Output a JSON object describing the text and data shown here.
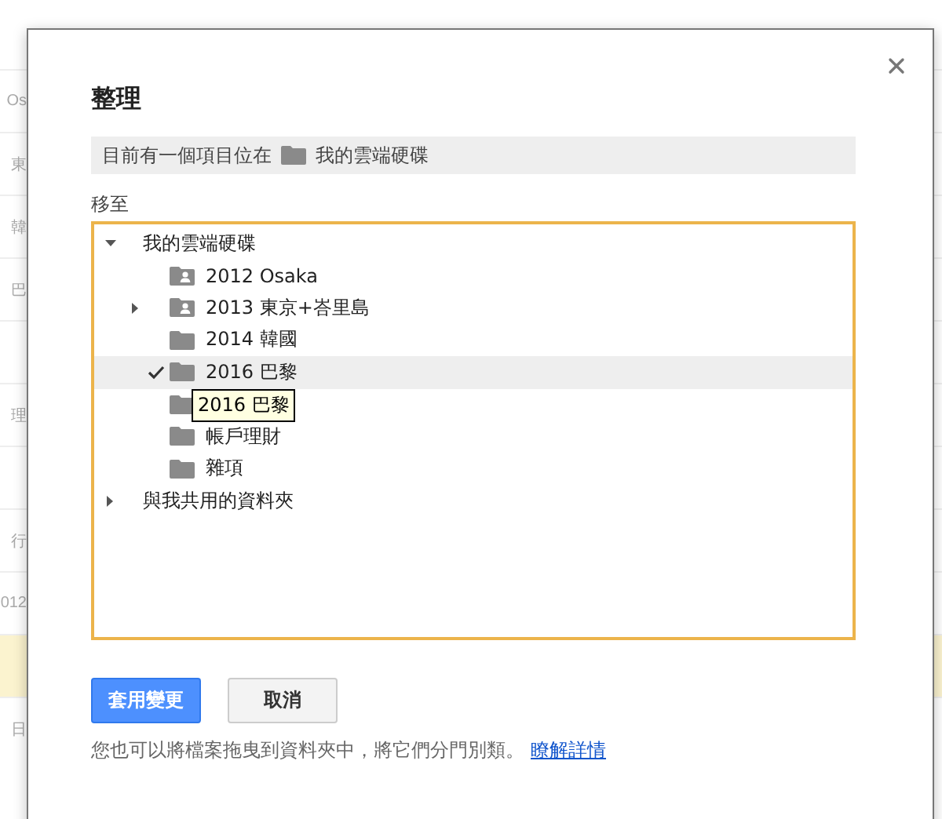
{
  "background_list": [
    {
      "text": "Os",
      "highlighted": false
    },
    {
      "text": "東",
      "highlighted": false
    },
    {
      "text": "韓",
      "highlighted": false
    },
    {
      "text": "巴",
      "highlighted": false
    },
    {
      "highlighted": false
    },
    {
      "text": "理",
      "highlighted": false
    },
    {
      "highlighted": false
    },
    {
      "text": "行",
      "highlighted": false
    },
    {
      "text": "012",
      "highlighted": false
    },
    {
      "highlighted": true
    },
    {
      "text": "日",
      "highlighted": false
    }
  ],
  "dialog": {
    "title": "整理",
    "location": {
      "prefix": "目前有一個項目位在",
      "folder": "我的雲端硬碟"
    },
    "move_to_label": "移至",
    "tree": [
      {
        "label": "我的雲端硬碟",
        "has_children": true,
        "expanded": true,
        "selected": false,
        "children": [
          {
            "label": "2012 Osaka",
            "kind": "shared_folder",
            "has_children": false,
            "selected": false
          },
          {
            "label": "2013 東京+峇里島",
            "kind": "shared_folder",
            "has_children": true,
            "expanded": false,
            "selected": false
          },
          {
            "label": "2014 韓國",
            "kind": "folder",
            "has_children": false,
            "selected": false
          },
          {
            "label": "2016 巴黎",
            "kind": "folder",
            "has_children": false,
            "selected": true
          },
          {
            "kind": "folder",
            "has_children": false,
            "selected": false
          },
          {
            "label": "帳戶理財",
            "kind": "folder",
            "has_children": false,
            "selected": false
          },
          {
            "label": "雜項",
            "kind": "folder",
            "has_children": false,
            "selected": false
          }
        ]
      },
      {
        "label": "與我共用的資料夾",
        "has_children": true,
        "expanded": false,
        "selected": false
      }
    ],
    "tooltip": "2016 巴黎",
    "buttons": [
      {
        "label": "套用變更",
        "kind": "primary"
      },
      {
        "label": "取消",
        "kind": "secondary"
      }
    ],
    "footer": {
      "text": "您也可以將檔案拖曳到資料夾中，將它們分門別類。",
      "link": "瞭解詳情"
    }
  }
}
